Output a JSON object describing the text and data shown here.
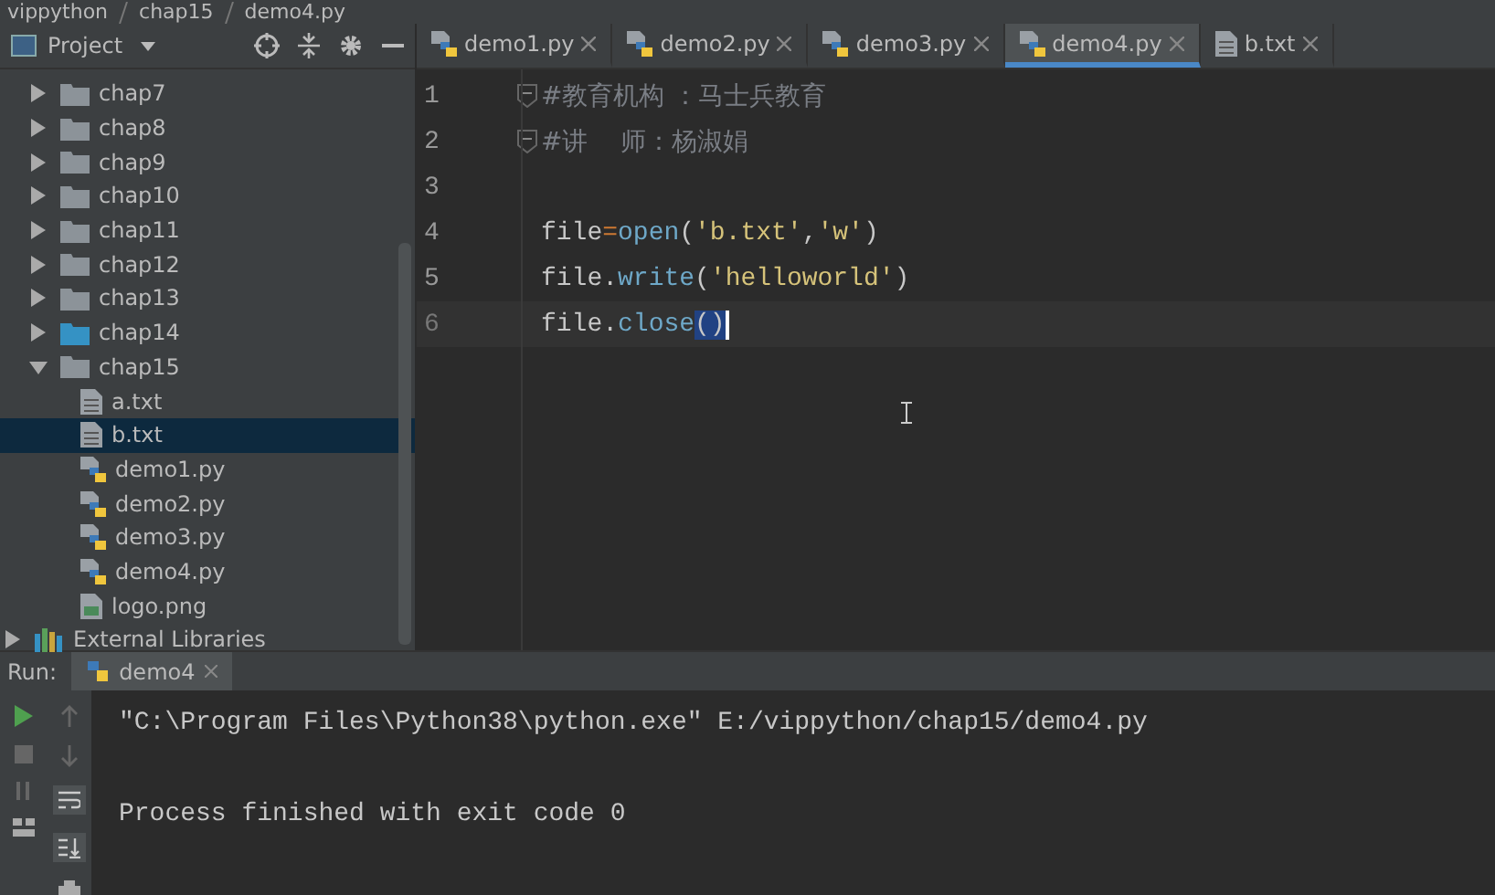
{
  "breadcrumb": [
    "vippython",
    "chap15",
    "demo4.py"
  ],
  "project_panel": {
    "title": "Project",
    "tree": [
      {
        "label": "chap7",
        "kind": "folder",
        "expanded": false,
        "selected": false
      },
      {
        "label": "chap8",
        "kind": "folder",
        "expanded": false,
        "selected": false
      },
      {
        "label": "chap9",
        "kind": "folder",
        "expanded": false,
        "selected": false
      },
      {
        "label": "chap10",
        "kind": "folder",
        "expanded": false,
        "selected": false
      },
      {
        "label": "chap11",
        "kind": "folder",
        "expanded": false,
        "selected": false
      },
      {
        "label": "chap12",
        "kind": "folder",
        "expanded": false,
        "selected": false
      },
      {
        "label": "chap13",
        "kind": "folder",
        "expanded": false,
        "selected": false
      },
      {
        "label": "chap14",
        "kind": "source-folder",
        "expanded": false,
        "selected": false
      },
      {
        "label": "chap15",
        "kind": "folder",
        "expanded": true,
        "selected": false,
        "children": [
          {
            "label": "a.txt",
            "kind": "text",
            "selected": false
          },
          {
            "label": "b.txt",
            "kind": "text",
            "selected": true
          },
          {
            "label": "demo1.py",
            "kind": "python",
            "selected": false
          },
          {
            "label": "demo2.py",
            "kind": "python",
            "selected": false
          },
          {
            "label": "demo3.py",
            "kind": "python",
            "selected": false
          },
          {
            "label": "demo4.py",
            "kind": "python",
            "selected": false
          },
          {
            "label": "logo.png",
            "kind": "image",
            "selected": false
          }
        ]
      },
      {
        "label": "External Libraries",
        "kind": "library",
        "expanded": false,
        "selected": false
      }
    ]
  },
  "tabs": [
    {
      "label": "demo1.py",
      "kind": "python",
      "selected": false
    },
    {
      "label": "demo2.py",
      "kind": "python",
      "selected": false
    },
    {
      "label": "demo3.py",
      "kind": "python",
      "selected": false
    },
    {
      "label": "demo4.py",
      "kind": "python",
      "selected": true
    },
    {
      "label": "b.txt",
      "kind": "text",
      "selected": false
    }
  ],
  "editor": {
    "lines": [
      {
        "number": "1",
        "fold": true,
        "current": false,
        "tokens": [
          {
            "text": "#教育机构 ：马士兵教育",
            "kind": "comment"
          }
        ]
      },
      {
        "number": "2",
        "fold": true,
        "current": false,
        "tokens": [
          {
            "text": "#讲    师：杨淑娟",
            "kind": "comment"
          }
        ]
      },
      {
        "number": "3",
        "fold": false,
        "current": false
      },
      {
        "number": "4",
        "fold": false,
        "current": false,
        "tokens": [
          {
            "text": "file",
            "kind": "plain"
          },
          {
            "text": "=",
            "kind": "operator"
          },
          {
            "text": "open",
            "kind": "builtin"
          },
          {
            "text": "(",
            "kind": "plain"
          },
          {
            "text": "'b.txt'",
            "kind": "string"
          },
          {
            "text": ",",
            "kind": "plain"
          },
          {
            "text": "'w'",
            "kind": "string"
          },
          {
            "text": ")",
            "kind": "plain"
          }
        ]
      },
      {
        "number": "5",
        "fold": false,
        "current": false,
        "tokens": [
          {
            "text": "file.",
            "kind": "plain"
          },
          {
            "text": "write",
            "kind": "builtin"
          },
          {
            "text": "(",
            "kind": "plain"
          },
          {
            "text": "'helloworld'",
            "kind": "string"
          },
          {
            "text": ")",
            "kind": "plain"
          }
        ]
      },
      {
        "number": "6",
        "fold": false,
        "current": true,
        "tokens": [
          {
            "text": "file.",
            "kind": "plain"
          },
          {
            "text": "close",
            "kind": "builtin"
          },
          {
            "text": "()",
            "kind": "selection"
          }
        ]
      }
    ]
  },
  "run_panel": {
    "label": "Run:",
    "tab": "demo4",
    "output": [
      "\"C:\\Program Files\\Python38\\python.exe\" E:/vippython/chap15/demo4.py",
      "Process finished with exit code 0"
    ]
  }
}
